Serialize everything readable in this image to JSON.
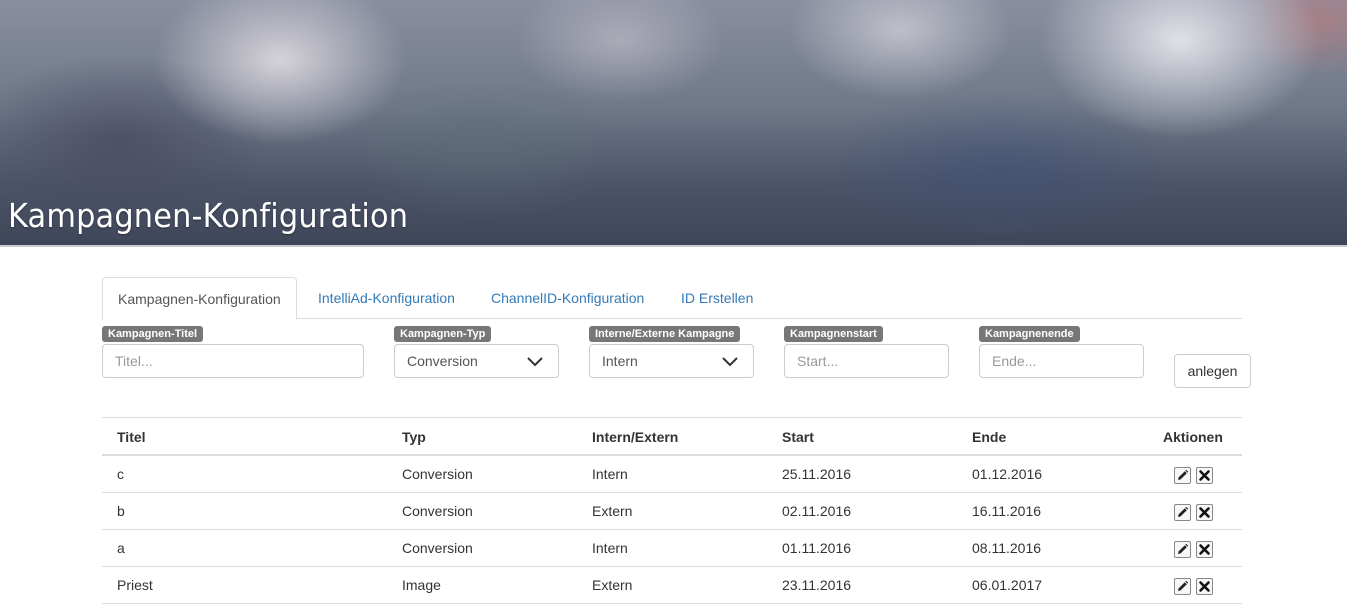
{
  "header": {
    "title": "Kampagnen-Konfiguration"
  },
  "tabs": [
    {
      "label": "Kampagnen-Konfiguration",
      "active": true
    },
    {
      "label": "IntelliAd-Konfiguration",
      "active": false
    },
    {
      "label": "ChannelID-Konfiguration",
      "active": false
    },
    {
      "label": "ID Erstellen",
      "active": false
    }
  ],
  "form": {
    "title": {
      "label": "Kampagnen-Titel",
      "placeholder": "Titel...",
      "value": ""
    },
    "type": {
      "label": "Kampagnen-Typ",
      "value": "Conversion"
    },
    "internal_external": {
      "label": "Interne/Externe Kampagne",
      "value": "Intern"
    },
    "start": {
      "label": "Kampagnenstart",
      "placeholder": "Start...",
      "value": ""
    },
    "end": {
      "label": "Kampagnenende",
      "placeholder": "Ende...",
      "value": ""
    },
    "create_label": "anlegen"
  },
  "table": {
    "headers": [
      "Titel",
      "Typ",
      "Intern/Extern",
      "Start",
      "Ende",
      "Aktionen"
    ],
    "rows": [
      {
        "title": "c",
        "type": "Conversion",
        "ie": "Intern",
        "start": "25.11.2016",
        "end": "01.12.2016"
      },
      {
        "title": "b",
        "type": "Conversion",
        "ie": "Extern",
        "start": "02.11.2016",
        "end": "16.11.2016"
      },
      {
        "title": "a",
        "type": "Conversion",
        "ie": "Intern",
        "start": "01.11.2016",
        "end": "08.11.2016"
      },
      {
        "title": "Priest",
        "type": "Image",
        "ie": "Extern",
        "start": "23.11.2016",
        "end": "06.01.2017"
      }
    ],
    "row_action_icons": [
      "pencil-icon",
      "x-icon"
    ]
  },
  "colors": {
    "link": "#337ab7",
    "label_badge": "#777777",
    "border": "#dddddd"
  }
}
